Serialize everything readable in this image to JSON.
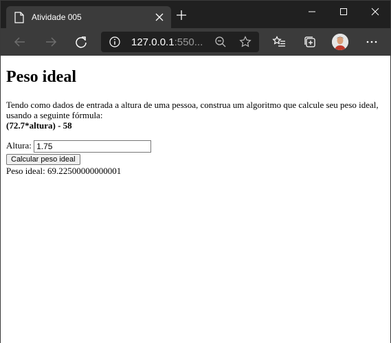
{
  "browser": {
    "tab": {
      "title": "Atividade 005"
    },
    "address": {
      "host": "127.0.0.1",
      "rest": ":550..."
    },
    "icons": [
      "page-icon",
      "close-icon",
      "plus-icon",
      "minimize-icon",
      "maximize-icon",
      "window-close-icon",
      "back-icon",
      "forward-icon",
      "refresh-icon",
      "info-icon",
      "zoom-out-icon",
      "star-icon",
      "favorites-icon",
      "collections-icon",
      "profile-avatar",
      "more-icon"
    ]
  },
  "page": {
    "title": "Peso ideal",
    "description": "Tendo como dados de entrada a altura de uma pessoa, construa um algoritmo que calcule seu peso ideal, usando a seguinte fórmula:",
    "formula": "(72.7*altura) - 58",
    "altura_label": "Altura:",
    "altura_value": "1.75",
    "button_label": "Calcular peso ideal",
    "result_label": "Peso ideal:",
    "result_value": "69.22500000000001"
  }
}
